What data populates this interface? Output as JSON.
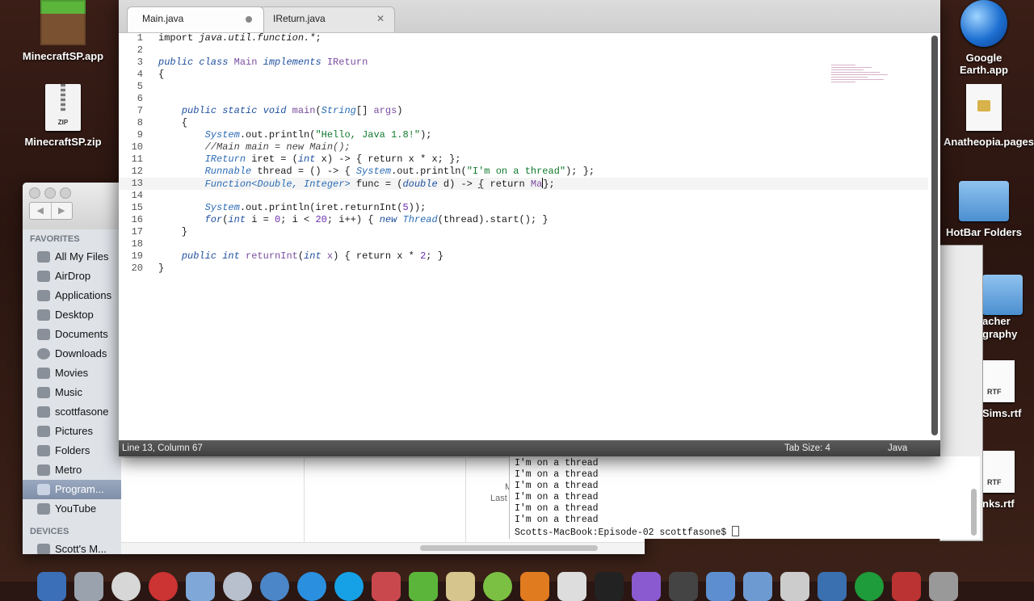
{
  "desktop": {
    "icons_left": [
      {
        "label": "MinecraftSP.app"
      },
      {
        "label": "MinecraftSP.zip",
        "badge": "ZIP"
      }
    ],
    "icons_right": [
      {
        "label": "Google Earth.app"
      },
      {
        "label": "Anatheopia.pages"
      },
      {
        "label": "HotBar Folders"
      },
      {
        "label": "acher graphy"
      },
      {
        "label": "Sims.rtf",
        "badge": "RTF"
      },
      {
        "label": "nks.rtf",
        "badge": "RTF"
      }
    ]
  },
  "finder": {
    "favorites_heading": "FAVORITES",
    "devices_heading": "DEVICES",
    "favorites": [
      {
        "label": "All My Files"
      },
      {
        "label": "AirDrop"
      },
      {
        "label": "Applications"
      },
      {
        "label": "Desktop"
      },
      {
        "label": "Documents"
      },
      {
        "label": "Downloads"
      },
      {
        "label": "Movies"
      },
      {
        "label": "Music"
      },
      {
        "label": "scottfasone"
      },
      {
        "label": "Pictures"
      },
      {
        "label": "Folders"
      },
      {
        "label": "Metro"
      },
      {
        "label": "Program...",
        "selected": true
      },
      {
        "label": "YouTube"
      }
    ],
    "devices": [
      {
        "label": "Scott's M..."
      }
    ],
    "meta_fragments": [
      "M",
      "Last"
    ],
    "nav_back": "◀",
    "nav_forward": "▶"
  },
  "terminal": {
    "lines": [
      "I'm on a thread",
      "I'm on a thread",
      "I'm on a thread",
      "I'm on a thread",
      "I'm on a thread",
      "I'm on a thread"
    ],
    "prompt": "Scotts-MacBook:Episode-02 scottfasone$ "
  },
  "editor": {
    "tabs": [
      {
        "label": "Main.java",
        "active": true,
        "modified": true
      },
      {
        "label": "IReturn.java",
        "active": false,
        "close": "✕"
      }
    ],
    "line_numbers": [
      "1",
      "2",
      "3",
      "4",
      "5",
      "6",
      "7",
      "8",
      "9",
      "10",
      "11",
      "12",
      "13",
      "14",
      "15",
      "16",
      "17",
      "18",
      "19",
      "20"
    ],
    "status": {
      "position": "Line 13, Column 67",
      "tab_size": "Tab Size: 4",
      "syntax": "Java"
    }
  },
  "colors": {
    "keyword": "#1e4f9e",
    "string": "#117a2e",
    "number": "#6a2fb0",
    "statusbar": "#4a4a4a"
  }
}
